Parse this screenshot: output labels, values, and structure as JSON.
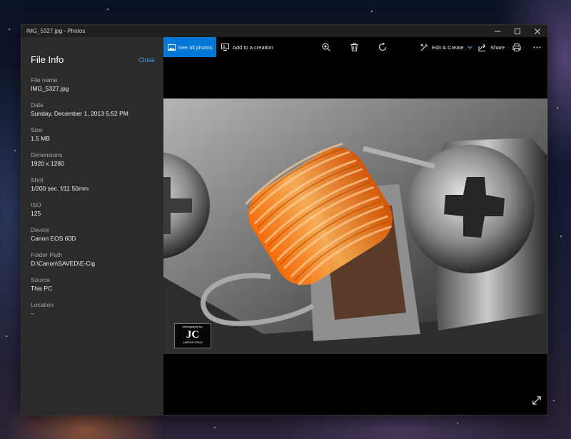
{
  "window": {
    "title": "IMG_5327.jpg - Photos",
    "controls": [
      "minimize-icon",
      "maximize-icon",
      "close-icon"
    ]
  },
  "panel": {
    "title": "File Info",
    "close_label": "Close",
    "fields": [
      {
        "label": "File name",
        "value": "IMG_5327.jpg"
      },
      {
        "label": "Date",
        "value": "Sunday, December 1, 2013 5:52 PM"
      },
      {
        "label": "Size",
        "value": "1.5 MB"
      },
      {
        "label": "Dimensions",
        "value": "1920 x 1280"
      },
      {
        "label": "Shot",
        "value": "1/200 sec. f/11 50mm"
      },
      {
        "label": "ISO",
        "value": "125"
      },
      {
        "label": "Device",
        "value": "Canon EOS 60D"
      },
      {
        "label": "Folder Path",
        "value": "D:\\Canon\\SAVED\\E-Cig"
      },
      {
        "label": "Source",
        "value": "This PC"
      },
      {
        "label": "Location",
        "value": "--"
      }
    ]
  },
  "toolbar": {
    "see_all_label": "See all photos",
    "add_creation_label": "Add to a creation",
    "edit_create_label": "Edit & Create",
    "share_label": "Share",
    "icons": [
      "photos-icon",
      "creation-icon",
      "zoom-icon",
      "delete-icon",
      "rotate-icon",
      "edit-icon",
      "share-icon",
      "print-icon",
      "more-icon"
    ]
  },
  "photo": {
    "watermark_label": "photography by:",
    "watermark_initials": "JC",
    "watermark_name": "JASFER CRUZ"
  },
  "colors": {
    "accent": "#0078d7",
    "link": "#4c9ee8",
    "panel_bg": "#2b2b2b",
    "coil": "#ff8a1f"
  }
}
